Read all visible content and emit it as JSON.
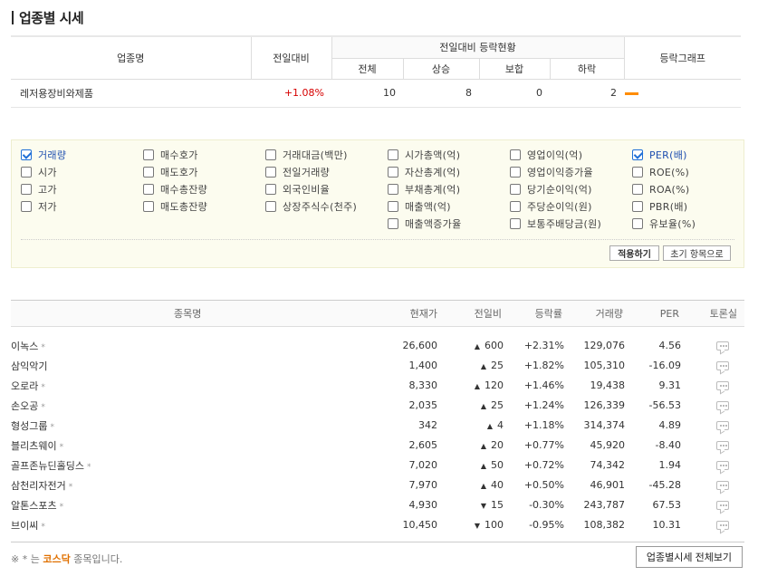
{
  "title": "업종별 시세",
  "summary": {
    "headers": {
      "name": "업종명",
      "prev_change": "전일대비",
      "group": "전일대비 등락현황",
      "total": "전체",
      "up": "상승",
      "flat": "보합",
      "down": "하락",
      "graph": "등락그래프"
    },
    "row": {
      "name": "레저용장비와제품",
      "change": "+1.08%",
      "total": "10",
      "up": "8",
      "flat": "0",
      "down": "2"
    },
    "graph_color": "#ff8c00"
  },
  "options": [
    {
      "label": "거래량",
      "checked": true
    },
    {
      "label": "시가",
      "checked": false
    },
    {
      "label": "고가",
      "checked": false
    },
    {
      "label": "저가",
      "checked": false
    },
    {
      "label": "매수호가",
      "checked": false
    },
    {
      "label": "매도호가",
      "checked": false
    },
    {
      "label": "매수총잔량",
      "checked": false
    },
    {
      "label": "매도총잔량",
      "checked": false
    },
    {
      "label": "거래대금(백만)",
      "checked": false
    },
    {
      "label": "전일거래량",
      "checked": false
    },
    {
      "label": "외국인비율",
      "checked": false
    },
    {
      "label": "상장주식수(천주)",
      "checked": false
    },
    {
      "label": "시가총액(억)",
      "checked": false
    },
    {
      "label": "자산총계(억)",
      "checked": false
    },
    {
      "label": "부채총계(억)",
      "checked": false
    },
    {
      "label": "매출액(억)",
      "checked": false
    },
    {
      "label": "매출액증가율",
      "checked": false
    },
    {
      "label": "영업이익(억)",
      "checked": false
    },
    {
      "label": "영업이익증가율",
      "checked": false
    },
    {
      "label": "당기순이익(억)",
      "checked": false
    },
    {
      "label": "주당순이익(원)",
      "checked": false
    },
    {
      "label": "보통주배당금(원)",
      "checked": false
    },
    {
      "label": "PER(배)",
      "checked": true
    },
    {
      "label": "ROE(%)",
      "checked": false
    },
    {
      "label": "ROA(%)",
      "checked": false
    },
    {
      "label": "PBR(배)",
      "checked": false
    },
    {
      "label": "유보율(%)",
      "checked": false
    }
  ],
  "buttons": {
    "apply": "적용하기",
    "reset": "초기 항목으로",
    "view_all": "업종별시세 전체보기"
  },
  "list": {
    "headers": {
      "name": "종목명",
      "price": "현재가",
      "diff": "전일비",
      "rate": "등락률",
      "volume": "거래량",
      "per": "PER",
      "forum": "토론실"
    },
    "rows": [
      {
        "name": "이녹스",
        "kosdaq": true,
        "price": "26,600",
        "dir": "up",
        "diff": "600",
        "rate": "+2.31%",
        "volume": "129,076",
        "per": "4.56"
      },
      {
        "name": "삼익악기",
        "kosdaq": false,
        "price": "1,400",
        "dir": "up",
        "diff": "25",
        "rate": "+1.82%",
        "volume": "105,310",
        "per": "-16.09"
      },
      {
        "name": "오로라",
        "kosdaq": true,
        "price": "8,330",
        "dir": "up",
        "diff": "120",
        "rate": "+1.46%",
        "volume": "19,438",
        "per": "9.31"
      },
      {
        "name": "손오공",
        "kosdaq": true,
        "price": "2,035",
        "dir": "up",
        "diff": "25",
        "rate": "+1.24%",
        "volume": "126,339",
        "per": "-56.53"
      },
      {
        "name": "형성그룹",
        "kosdaq": true,
        "price": "342",
        "dir": "up",
        "diff": "4",
        "rate": "+1.18%",
        "volume": "314,374",
        "per": "4.89"
      },
      {
        "name": "블리츠웨이",
        "kosdaq": true,
        "price": "2,605",
        "dir": "up",
        "diff": "20",
        "rate": "+0.77%",
        "volume": "45,920",
        "per": "-8.40"
      },
      {
        "name": "골프존뉴딘홀딩스",
        "kosdaq": true,
        "price": "7,020",
        "dir": "up",
        "diff": "50",
        "rate": "+0.72%",
        "volume": "74,342",
        "per": "1.94"
      },
      {
        "name": "삼천리자전거",
        "kosdaq": true,
        "price": "7,970",
        "dir": "up",
        "diff": "40",
        "rate": "+0.50%",
        "volume": "46,901",
        "per": "-45.28"
      },
      {
        "name": "알톤스포츠",
        "kosdaq": true,
        "price": "4,930",
        "dir": "down",
        "diff": "15",
        "rate": "-0.30%",
        "volume": "243,787",
        "per": "67.53"
      },
      {
        "name": "브이씨",
        "kosdaq": true,
        "price": "10,450",
        "dir": "down",
        "diff": "100",
        "rate": "-0.95%",
        "volume": "108,382",
        "per": "10.31"
      }
    ]
  },
  "footnote": {
    "prefix": "※ * 는",
    "kosdaq": "코스닥",
    "suffix": "종목입니다."
  },
  "colors": {
    "up": "#d60000",
    "down": "#1e5bd6"
  }
}
